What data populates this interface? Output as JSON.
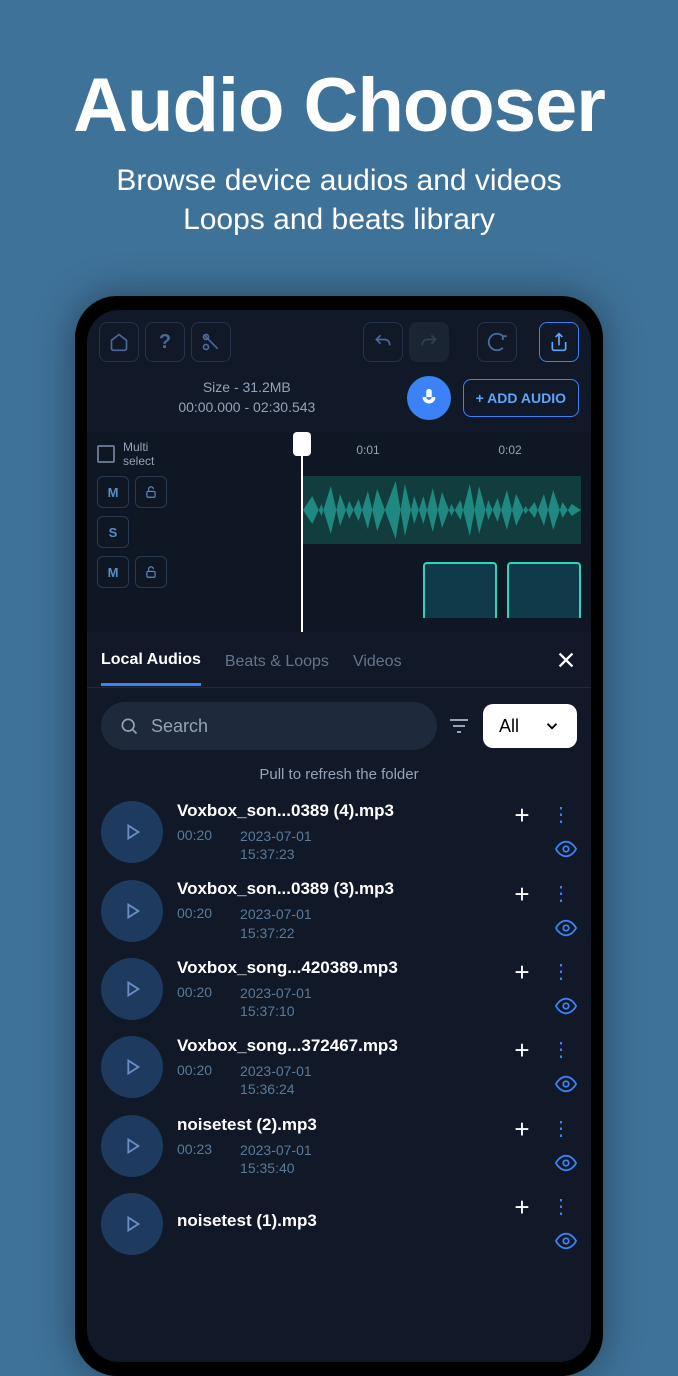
{
  "hero": {
    "title": "Audio Chooser",
    "sub1": "Browse device audios and videos",
    "sub2": "Loops and beats library"
  },
  "toolbar": {
    "size_label": "Size - 31.2MB",
    "time_range": "00:00.000 - 02:30.543",
    "add_audio": "+ ADD AUDIO"
  },
  "timeline": {
    "multi": "Multi select",
    "t1": "0:01",
    "t2": "0:02"
  },
  "tracks": {
    "m": "M",
    "s": "S"
  },
  "tabs": {
    "local": "Local Audios",
    "beats": "Beats & Loops",
    "videos": "Videos"
  },
  "search": {
    "placeholder": "Search",
    "filter": "All"
  },
  "pull": "Pull to refresh the folder",
  "items": [
    {
      "title": "Voxbox_son...0389 (4).mp3",
      "dur": "00:20",
      "date": "2023-07-01",
      "time": "15:37:23"
    },
    {
      "title": "Voxbox_son...0389 (3).mp3",
      "dur": "00:20",
      "date": "2023-07-01",
      "time": "15:37:22"
    },
    {
      "title": "Voxbox_song...420389.mp3",
      "dur": "00:20",
      "date": "2023-07-01",
      "time": "15:37:10"
    },
    {
      "title": "Voxbox_song...372467.mp3",
      "dur": "00:20",
      "date": "2023-07-01",
      "time": "15:36:24"
    },
    {
      "title": "noisetest (2).mp3",
      "dur": "00:23",
      "date": "2023-07-01",
      "time": "15:35:40"
    },
    {
      "title": "noisetest (1).mp3",
      "dur": "",
      "date": "",
      "time": ""
    }
  ]
}
